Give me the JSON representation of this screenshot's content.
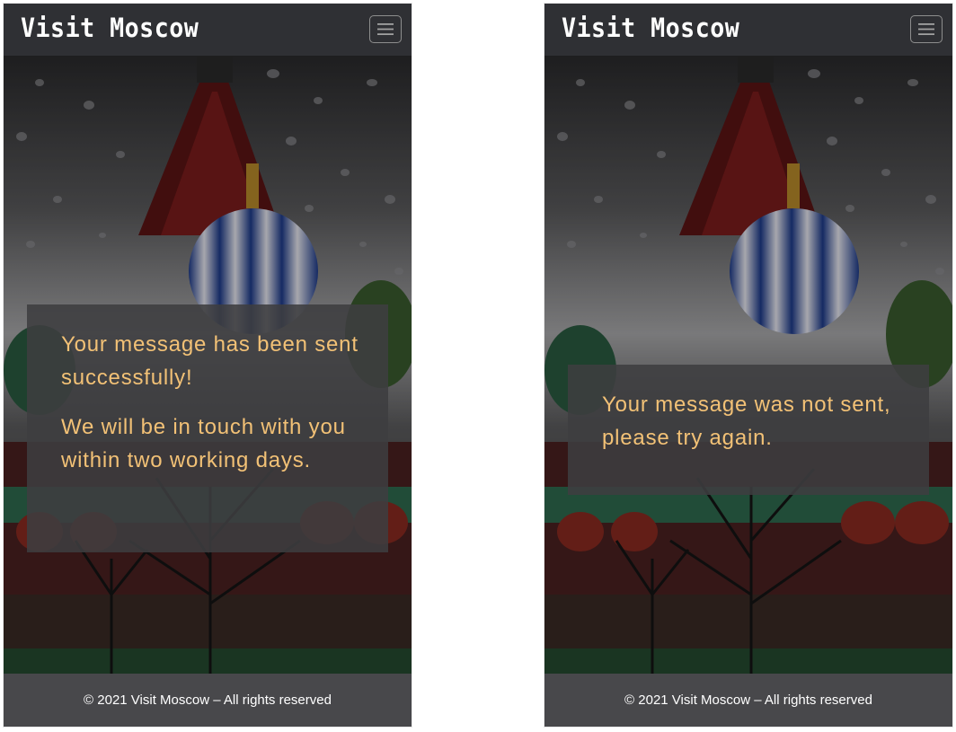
{
  "screens": [
    {
      "brand": "Visit Moscow",
      "messages": [
        "Your message has been sent successfully!",
        "We will be in touch with you within two working days."
      ],
      "footer": "© 2021 Visit Moscow – All rights reserved"
    },
    {
      "brand": "Visit Moscow",
      "messages": [
        "Your message was not sent, please try again."
      ],
      "footer": "© 2021 Visit Moscow – All rights reserved"
    }
  ],
  "icons": {
    "menu": "hamburger-menu-icon",
    "background": "st-basils-cathedral-photo"
  },
  "colors": {
    "navbar": "#2f3034",
    "footer": "#48484b",
    "message_text": "#f2c176",
    "message_box": "#3e3e40"
  }
}
